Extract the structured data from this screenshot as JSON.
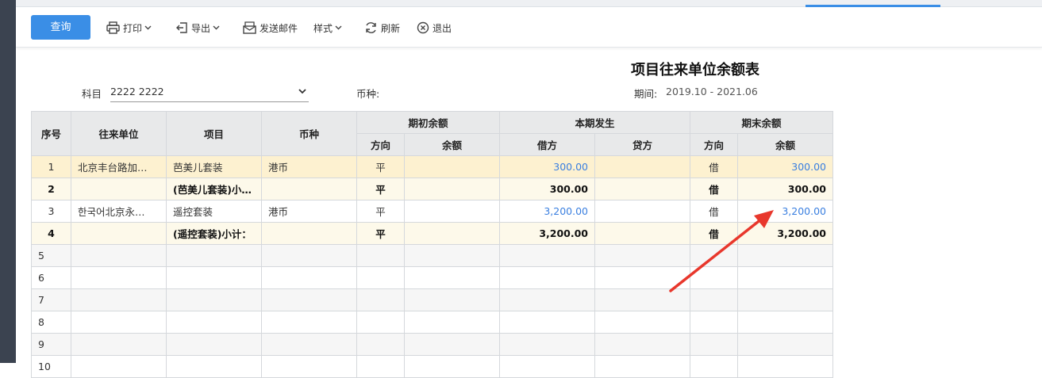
{
  "toolbar": {
    "query_label": "查询",
    "print_label": "打印",
    "export_label": "导出",
    "email_label": "发送邮件",
    "style_label": "样式",
    "refresh_label": "刷新",
    "exit_label": "退出"
  },
  "report": {
    "title": "项目往来单位余额表",
    "subject_label": "科目",
    "subject_value": "2222 2222",
    "currency_label": "币种:",
    "period_label": "期间:",
    "period_value": "2019.10 - 2021.06"
  },
  "table": {
    "headers": {
      "index": "序号",
      "partner": "往来单位",
      "project": "项目",
      "currency": "币种",
      "opening": "期初余额",
      "current": "本期发生",
      "closing": "期末余额",
      "direction": "方向",
      "balance": "余额",
      "debit": "借方",
      "credit": "贷方"
    },
    "rows": [
      {
        "no": "1",
        "partner": "北京丰台路加…",
        "project": "芭美儿套装",
        "currency": "港币",
        "open_dir": "平",
        "open_bal": "",
        "debit": "300.00",
        "credit": "",
        "close_dir": "借",
        "close_bal": "300.00"
      },
      {
        "no": "2",
        "partner": "",
        "project": "(芭美儿套装)小…",
        "currency": "",
        "open_dir": "平",
        "open_bal": "",
        "debit": "300.00",
        "credit": "",
        "close_dir": "借",
        "close_bal": "300.00"
      },
      {
        "no": "3",
        "partner": "한국어北京永…",
        "project": "遥控套装",
        "currency": "港币",
        "open_dir": "平",
        "open_bal": "",
        "debit": "3,200.00",
        "credit": "",
        "close_dir": "借",
        "close_bal": "3,200.00"
      },
      {
        "no": "4",
        "partner": "",
        "project": "(遥控套装)小计：",
        "currency": "",
        "open_dir": "平",
        "open_bal": "",
        "debit": "3,200.00",
        "credit": "",
        "close_dir": "借",
        "close_bal": "3,200.00"
      },
      {
        "no": "5"
      },
      {
        "no": "6"
      },
      {
        "no": "7"
      },
      {
        "no": "8"
      },
      {
        "no": "9"
      },
      {
        "no": "10"
      }
    ]
  },
  "colors": {
    "accent": "#3a8ee6",
    "link_blue": "#3a7fe0",
    "annotation_arrow": "#e8372c"
  }
}
